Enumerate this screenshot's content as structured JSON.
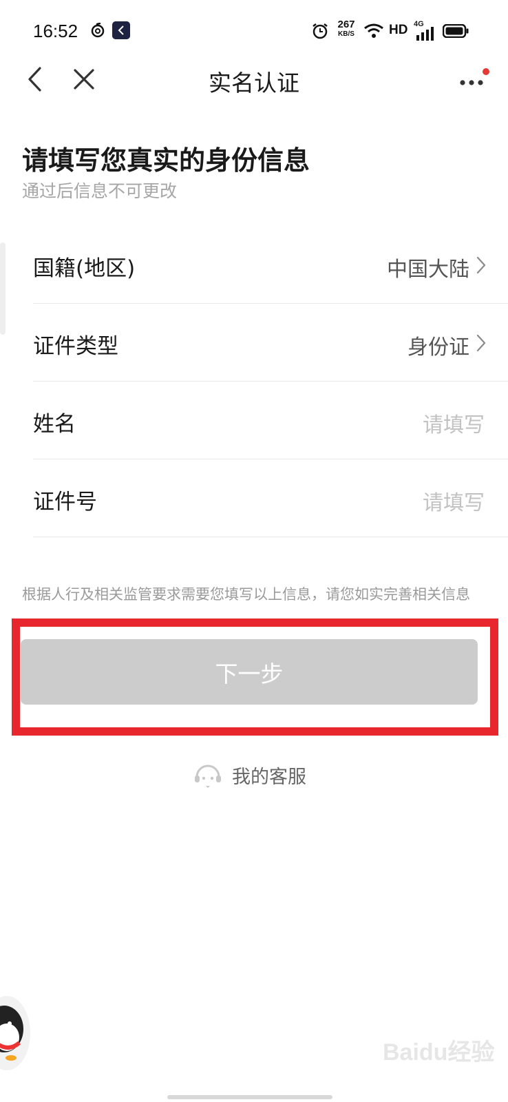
{
  "status_bar": {
    "time": "16:52",
    "net_speed_value": "267",
    "net_speed_unit": "KB/S",
    "hd": "HD",
    "network": "4G"
  },
  "nav": {
    "title": "实名认证",
    "notification_dot_color": "#e53935"
  },
  "heading": "请填写您真实的身份信息",
  "subheading": "通过后信息不可更改",
  "form": {
    "rows": [
      {
        "label": "国籍(地区)",
        "value": "中国大陆"
      },
      {
        "label": "证件类型",
        "value": "身份证"
      },
      {
        "label": "姓名",
        "placeholder": "请填写"
      },
      {
        "label": "证件号",
        "placeholder": "请填写"
      }
    ]
  },
  "notice": "根据人行及相关监管要求需要您填写以上信息，请您如实完善相关信息",
  "next_button": {
    "label": "下一步",
    "color": "#cccccc"
  },
  "highlight_color": "#e8262e",
  "service": {
    "label": "我的客服",
    "icon": "customer-service-icon"
  },
  "watermark": "Baidu经验"
}
